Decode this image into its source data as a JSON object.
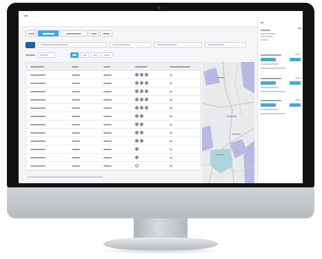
{
  "screen": {
    "tabs": [
      {
        "label": "",
        "active": false
      },
      {
        "label": "",
        "active": true
      },
      {
        "label": "",
        "active": false
      },
      {
        "label": "",
        "active": false
      },
      {
        "label": "",
        "active": false
      }
    ],
    "search": {
      "value": "",
      "placeholder": ""
    },
    "filter_fields": [
      {
        "value": ""
      },
      {
        "value": ""
      },
      {
        "value": ""
      }
    ],
    "filter_buttons": [
      {
        "label": "",
        "active": true
      },
      {
        "label": "",
        "active": false
      },
      {
        "label": "",
        "active": false
      },
      {
        "label": "",
        "active": false
      }
    ],
    "table": {
      "headers": [
        "",
        "",
        "",
        "",
        ""
      ],
      "rows": [
        {
          "cells": [
            "",
            "",
            "",
            "",
            ""
          ],
          "status_dots": 3
        },
        {
          "cells": [
            "",
            "",
            "",
            "",
            ""
          ],
          "status_dots": 3
        },
        {
          "cells": [
            "",
            "",
            "",
            "",
            ""
          ],
          "status_dots": 3
        },
        {
          "cells": [
            "",
            "",
            "",
            "",
            ""
          ],
          "status_dots": 3
        },
        {
          "cells": [
            "",
            "",
            "",
            "",
            ""
          ],
          "status_dots": 3
        },
        {
          "cells": [
            "",
            "",
            "",
            "",
            ""
          ],
          "status_dots": 2
        },
        {
          "cells": [
            "",
            "",
            "",
            "",
            ""
          ],
          "status_dots": 2
        },
        {
          "cells": [
            "",
            "",
            "",
            "",
            ""
          ],
          "status_dots": 2
        },
        {
          "cells": [
            "",
            "",
            "",
            "",
            ""
          ],
          "status_dots": 2
        },
        {
          "cells": [
            "",
            "",
            "",
            "",
            ""
          ],
          "status_dots": 1
        },
        {
          "cells": [
            "",
            "",
            "",
            "",
            ""
          ],
          "status_dots": 1
        },
        {
          "cells": [
            "",
            "",
            "",
            "",
            ""
          ],
          "status_dots": 0
        }
      ],
      "footer": ""
    },
    "panel": {
      "title": "",
      "subtitle": "",
      "sections": [
        {
          "heading": ""
        },
        {
          "heading": ""
        },
        {
          "heading": ""
        }
      ]
    }
  },
  "colors": {
    "accent": "#4aa8cc",
    "brand": "#1f5fa8",
    "bezel": "#111214",
    "map_water": "#9fd3dc",
    "map_area": "#b9b8e3"
  },
  "icons": [
    "app-logo-icon",
    "status-circle-icon",
    "map-icon"
  ]
}
